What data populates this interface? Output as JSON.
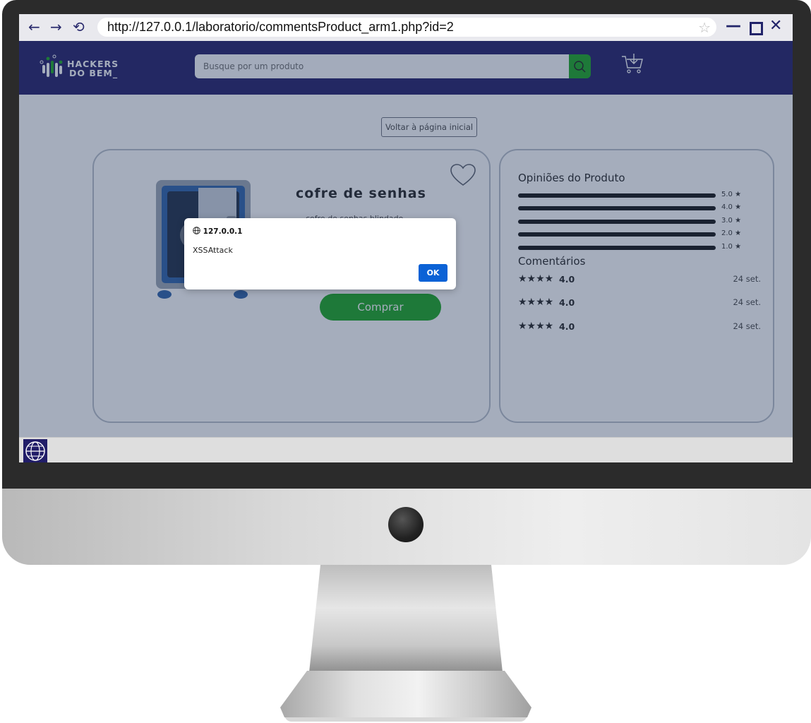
{
  "browser": {
    "back": "←",
    "forward": "→",
    "reload": "⟲",
    "url": "http://127.0.0.1/laboratorio/commentsProduct_arm1.php?id=2",
    "star": "☆",
    "minimize": "—",
    "close": "✕"
  },
  "header": {
    "logo_line1": "HACKERS",
    "logo_line2": "DO BEM_",
    "search_placeholder": "Busque por um produto",
    "colors": {
      "nav": "#1f1b67",
      "accent": "#18a51e"
    }
  },
  "page": {
    "back_link": "Voltar à página inicial",
    "product": {
      "title": "cofre de senhas",
      "description": "cofre de senhas blindado",
      "buy_label": "Comprar"
    },
    "reviews": {
      "title": "Opiniões do Produto",
      "ratings": [
        {
          "label": "5.0 ★"
        },
        {
          "label": "4.0 ★"
        },
        {
          "label": "3.0 ★"
        },
        {
          "label": "2.0 ★"
        },
        {
          "label": "1.0 ★"
        }
      ],
      "comments_title": "Comentários",
      "comments": [
        {
          "stars": "★★★★",
          "value": "4.0",
          "date": "24 set."
        },
        {
          "stars": "★★★★",
          "value": "4.0",
          "date": "24 set."
        },
        {
          "stars": "★★★★",
          "value": "4.0",
          "date": "24 set."
        }
      ]
    }
  },
  "dialog": {
    "origin": "127.0.0.1",
    "message": "XSSAttack",
    "ok": "OK"
  }
}
